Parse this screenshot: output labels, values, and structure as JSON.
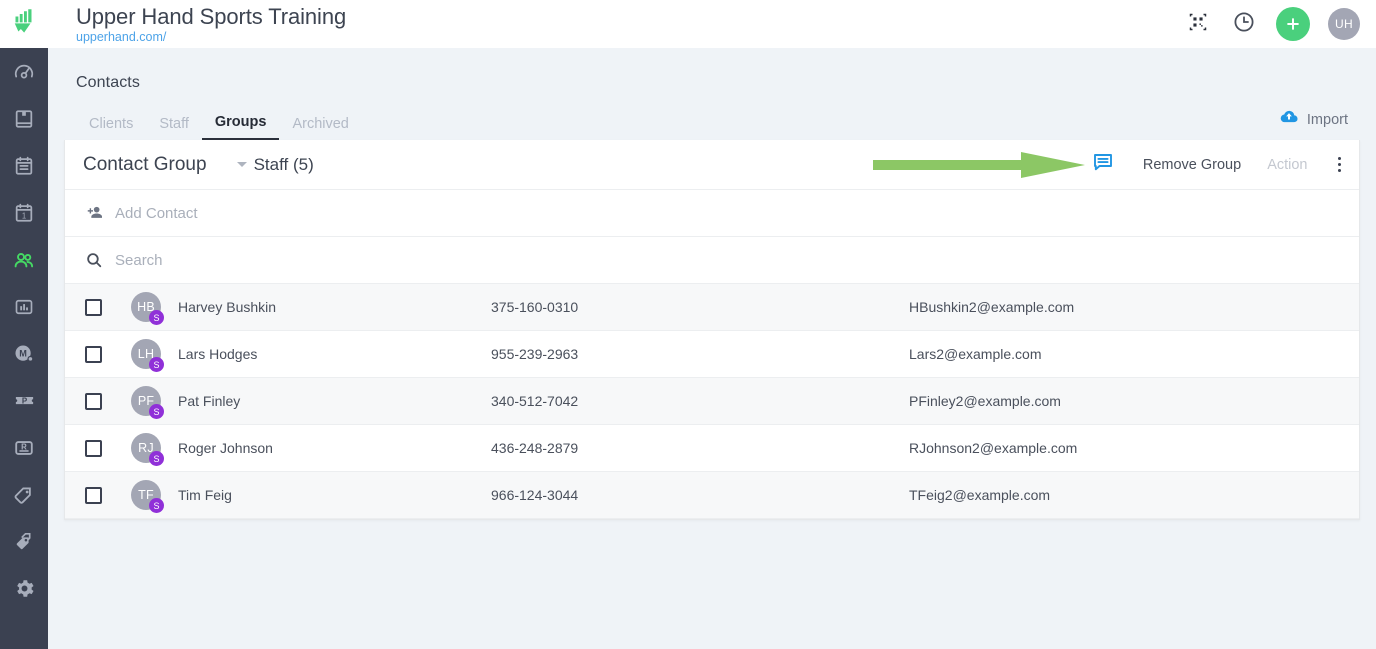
{
  "topbar": {
    "logo_icon": "upperhand-logo-icon",
    "title": "Upper Hand Sports Training",
    "url": "upperhand.com/",
    "qr_icon": "qr-code-icon",
    "clock_icon": "clock-icon",
    "add_icon": "plus-icon",
    "avatar_initials": "UH"
  },
  "sidebar": {
    "items": [
      {
        "name": "dashboard",
        "icon": "speedometer-icon",
        "active": false
      },
      {
        "name": "book",
        "icon": "book-icon",
        "active": false
      },
      {
        "name": "schedule",
        "icon": "clipboard-icon",
        "active": false
      },
      {
        "name": "calendar",
        "icon": "calendar-one-icon",
        "active": false
      },
      {
        "name": "contacts",
        "icon": "people-icon",
        "active": true
      },
      {
        "name": "reports",
        "icon": "bar-chart-icon",
        "active": false
      },
      {
        "name": "marketing",
        "icon": "m-circle-icon",
        "active": false
      },
      {
        "name": "passes",
        "icon": "p-ticket-icon",
        "active": false
      },
      {
        "name": "retail",
        "icon": "r-box-icon",
        "active": false
      },
      {
        "name": "products",
        "icon": "tag-icon",
        "active": false
      },
      {
        "name": "discounts",
        "icon": "double-tag-icon",
        "active": false
      },
      {
        "name": "settings",
        "icon": "gear-icon",
        "active": false
      }
    ]
  },
  "page": {
    "title": "Contacts",
    "tabs": [
      {
        "label": "Clients",
        "active": false
      },
      {
        "label": "Staff",
        "active": false
      },
      {
        "label": "Groups",
        "active": true
      },
      {
        "label": "Archived",
        "active": false
      }
    ],
    "import": {
      "label": "Import",
      "icon": "cloud-upload-icon"
    }
  },
  "card": {
    "header": {
      "title": "Contact Group",
      "selected_group": "Staff (5)",
      "message_icon": "message-bubble-icon",
      "remove_group_label": "Remove Group",
      "action_label": "Action",
      "kebab_icon": "more-vertical-icon"
    },
    "add_contact": {
      "placeholder": "Add Contact",
      "icon": "person-add-icon"
    },
    "search": {
      "placeholder": "Search",
      "icon": "search-icon"
    },
    "rows": [
      {
        "initials": "HB",
        "badge": "S",
        "name": "Harvey Bushkin",
        "phone": "375-160-0310",
        "email": "HBushkin2@example.com",
        "checked": false
      },
      {
        "initials": "LH",
        "badge": "S",
        "name": "Lars Hodges",
        "phone": "955-239-2963",
        "email": "Lars2@example.com",
        "checked": false
      },
      {
        "initials": "PF",
        "badge": "S",
        "name": "Pat Finley",
        "phone": "340-512-7042",
        "email": "PFinley2@example.com",
        "checked": false
      },
      {
        "initials": "RJ",
        "badge": "S",
        "name": "Roger Johnson",
        "phone": "436-248-2879",
        "email": "RJohnson2@example.com",
        "checked": false
      },
      {
        "initials": "TF",
        "badge": "S",
        "name": "Tim Feig",
        "phone": "966-124-3044",
        "email": "TFeig2@example.com",
        "checked": false
      }
    ]
  },
  "annotation": {
    "arrow_color": "#8cc765",
    "arrow_points_to": "message-bubble-icon"
  },
  "colors": {
    "brand_green": "#4ad07d",
    "sidebar_bg": "#3b4151",
    "page_bg": "#eff3f7",
    "link_blue": "#4da3e8",
    "badge_purple": "#9030d8",
    "icon_blue": "#2196e3"
  }
}
